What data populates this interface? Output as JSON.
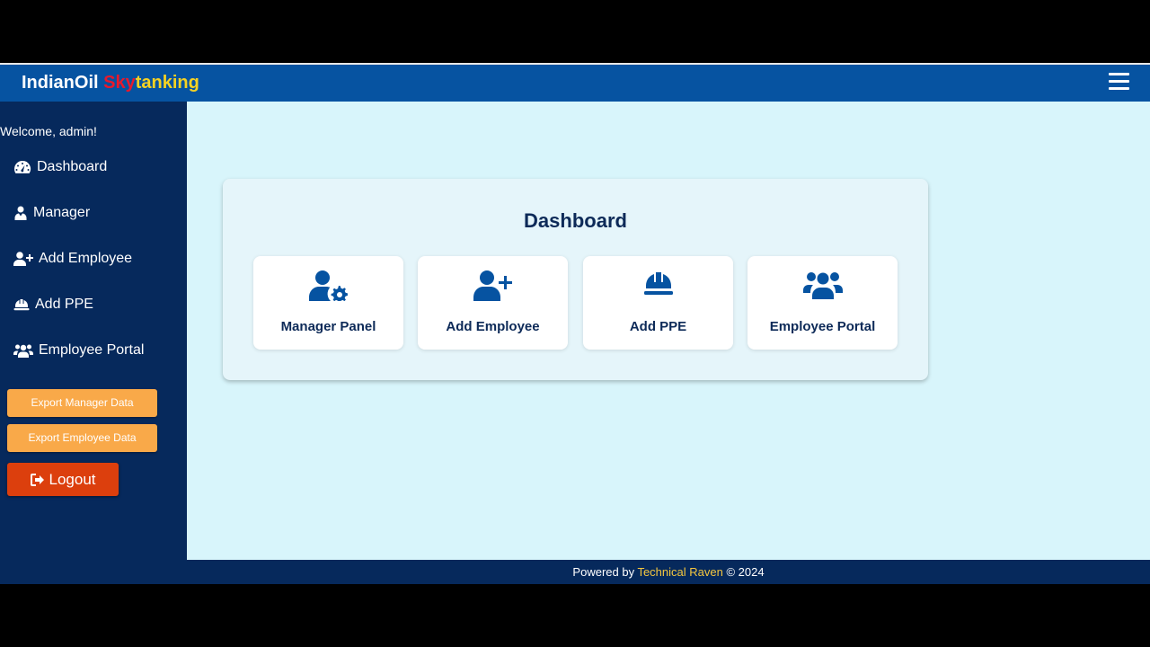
{
  "header": {
    "brand_part1": "IndianOil ",
    "brand_part2": "Sky",
    "brand_part3": "tanking",
    "menu_icon": "hamburger-icon"
  },
  "sidebar": {
    "welcome": "Welcome, admin!",
    "items": [
      {
        "label": "Dashboard",
        "icon": "tachometer-icon"
      },
      {
        "label": "Manager",
        "icon": "user-tie-icon"
      },
      {
        "label": "Add Employee",
        "icon": "user-plus-icon"
      },
      {
        "label": "Add PPE",
        "icon": "hard-hat-icon"
      },
      {
        "label": "Employee Portal",
        "icon": "users-icon"
      }
    ],
    "export_manager": "Export Manager Data",
    "export_employee": "Export Employee Data",
    "logout": "Logout"
  },
  "main": {
    "title": "Dashboard",
    "cards": [
      {
        "label": "Manager Panel",
        "icon": "user-gear-icon"
      },
      {
        "label": "Add Employee",
        "icon": "user-plus-icon"
      },
      {
        "label": "Add PPE",
        "icon": "hard-hat-icon"
      },
      {
        "label": "Employee Portal",
        "icon": "users-icon"
      }
    ]
  },
  "footer": {
    "prefix": "Powered by ",
    "link": "Technical Raven",
    "suffix": " © 2024"
  },
  "colors": {
    "navbar": "#0653a1",
    "sidebar": "#06295c",
    "content_bg": "#d8f5fb",
    "export_button": "#f9a949",
    "logout_button": "#dc3f0d",
    "brand_sky": "#e8192c",
    "brand_tanking": "#f5d223",
    "footer_link": "#f5c73f"
  }
}
